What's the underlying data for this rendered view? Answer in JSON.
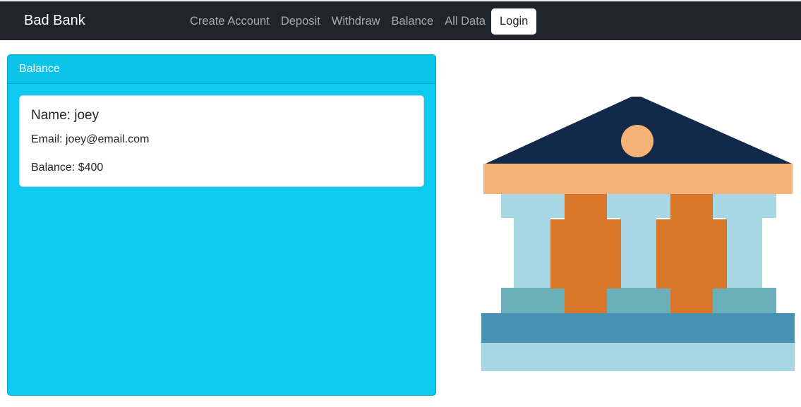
{
  "navbar": {
    "brand": "Bad Bank",
    "links": {
      "create_account": "Create Account",
      "deposit": "Deposit",
      "withdraw": "Withdraw",
      "balance": "Balance",
      "all_data": "All Data"
    },
    "login_label": "Login"
  },
  "balance_card": {
    "header": "Balance",
    "name": "Name: joey",
    "email": "Email: joey@email.com",
    "balance": "Balance: $400"
  },
  "illustration": {
    "icon": "bank-building-icon",
    "colors": {
      "roof": "#12294a",
      "peach": "#f4b278",
      "light_blue": "#a6d7e2",
      "orange": "#d9762a",
      "teal": "#6aafb9",
      "steel_blue": "#4792b3"
    }
  },
  "colors": {
    "navbar_bg": "#212529",
    "card_bg": "#0dcaf0"
  }
}
